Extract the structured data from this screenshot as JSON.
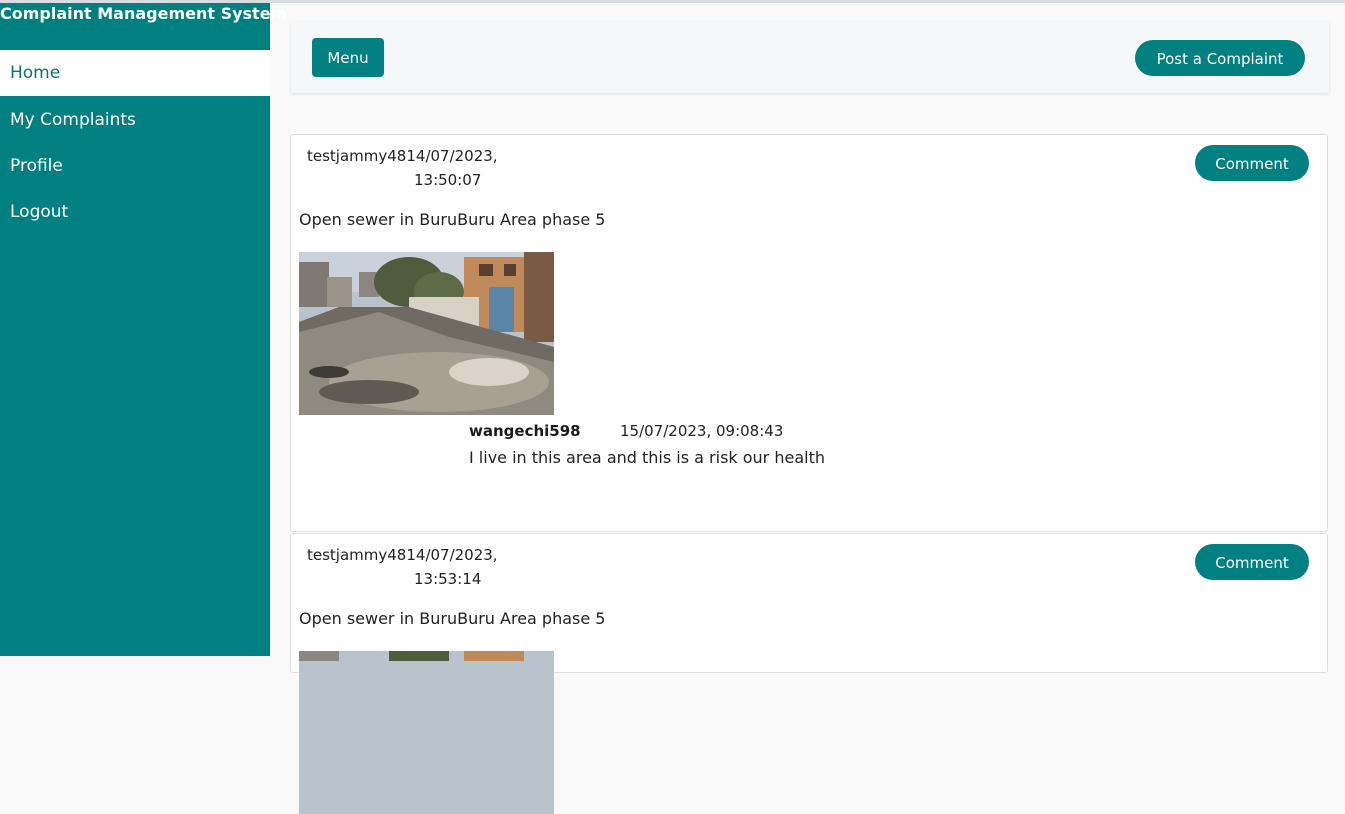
{
  "app": {
    "title": "Complaint Management System"
  },
  "sidebar": {
    "items": [
      {
        "label": "Home",
        "active": true
      },
      {
        "label": "My Complaints"
      },
      {
        "label": "Profile"
      },
      {
        "label": "Logout"
      }
    ]
  },
  "topbar": {
    "menu_label": "Menu",
    "post_label": "Post a Complaint"
  },
  "colors": {
    "accent": "#008080"
  },
  "complaints": [
    {
      "user_date": "testjammy4814/07/2023,",
      "time": "13:50:07",
      "comment_label": "Comment",
      "description": "Open sewer in BuruBuru Area phase 5",
      "image": "flooded-street-photo",
      "comments": [
        {
          "user": "wangechi598",
          "datetime": "15/07/2023, 09:08:43",
          "text": "I live in this area and this is a risk our health"
        }
      ]
    },
    {
      "user_date": "testjammy4814/07/2023,",
      "time": "13:53:14",
      "comment_label": "Comment",
      "description": "Open sewer in BuruBuru Area phase 5",
      "image": "flooded-street-photo"
    }
  ]
}
